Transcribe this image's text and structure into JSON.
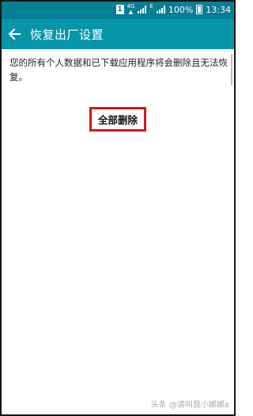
{
  "status_bar": {
    "sim_label": "1",
    "network_label": "4G",
    "network_type": "E",
    "battery": "100%",
    "time": "13:34"
  },
  "app_bar": {
    "back_icon": "arrow-left-icon",
    "title": "恢复出厂设置"
  },
  "content": {
    "description": "您的所有个人数据和已下载应用程序将会删除且无法恢复。",
    "delete_all_button": "全部删除"
  },
  "watermark": {
    "text": "头条 @请叫我小娜娜a"
  },
  "colors": {
    "status_bar": "#067e93",
    "app_bar": "#0795aa",
    "highlight_border": "#d6161c"
  }
}
